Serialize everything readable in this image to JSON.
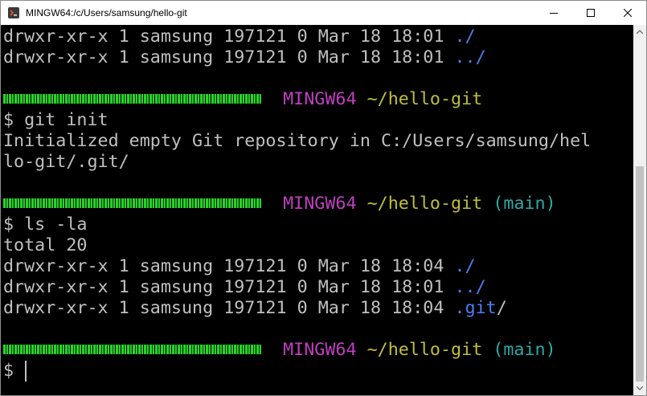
{
  "window": {
    "title": "MINGW64:/c/Users/samsung/hello-git",
    "icon": "mintty-git-icon"
  },
  "colors": {
    "text": "#c0c0c0",
    "dir": "#4f7df2",
    "prompt_host": "#bf3fbf",
    "prompt_path": "#bfbf3a",
    "prompt_branch": "#2faaa6",
    "redacted_user": "#2ad12a"
  },
  "terminal": {
    "l1": "drwxr-xr-x 1 samsung 197121 0 Mar 18 18:01 ",
    "l1_dir": "./",
    "l2": "drwxr-xr-x 1 samsung 197121 0 Mar 18 18:01 ",
    "l2_dir": "../",
    "p1_host": "MINGW64",
    "p1_path": "~/hello-git",
    "cmd1": "$ git init",
    "out1a": "Initialized empty Git repository in C:/Users/samsung/hel",
    "out1b": "lo-git/.git/",
    "p2_host": "MINGW64",
    "p2_path": "~/hello-git",
    "p2_branch": "(main)",
    "cmd2": "$ ls -la",
    "out2": "total 20",
    "r1": "drwxr-xr-x 1 samsung 197121 0 Mar 18 18:04 ",
    "r1_dir": "./",
    "r2": "drwxr-xr-x 1 samsung 197121 0 Mar 18 18:01 ",
    "r2_dir": "../",
    "r3": "drwxr-xr-x 1 samsung 197121 0 Mar 18 18:04 ",
    "r3_dir": ".git",
    "r3_slash": "/",
    "p3_host": "MINGW64",
    "p3_path": "~/hello-git",
    "p3_branch": "(main)",
    "prompt_symbol": "$"
  }
}
